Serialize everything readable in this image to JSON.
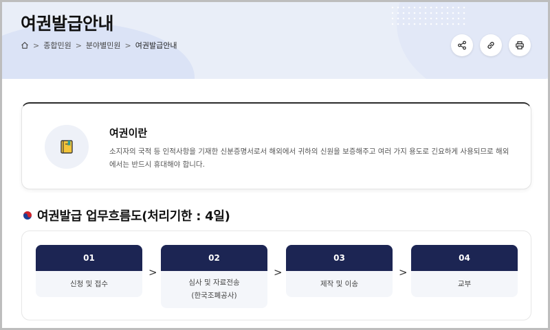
{
  "header": {
    "title": "여권발급안내",
    "breadcrumb": [
      "종합민원",
      "분야별민원",
      "여권발급안내"
    ],
    "tools": [
      {
        "name": "share-icon"
      },
      {
        "name": "link-icon"
      },
      {
        "name": "print-icon"
      }
    ]
  },
  "info": {
    "icon": "passport-book-icon",
    "title": "여권이란",
    "description": "소지자의 국적 등 인적사항을 기재한 신분증명서로서 해외에서 귀하의 신원을 보증해주고 여러 가지 용도로 긴요하게 사용되므로 해외에서는 반드시 휴대해야 합니다."
  },
  "flow": {
    "title": "여권발급 업무흐름도(처리기한 : 4일)",
    "steps": [
      {
        "number": "01",
        "label": "신청 및 접수",
        "sub": ""
      },
      {
        "number": "02",
        "label": "심사 및 자료전송",
        "sub": "(한국조폐공사)"
      },
      {
        "number": "03",
        "label": "제작 및 이송",
        "sub": ""
      },
      {
        "number": "04",
        "label": "교부",
        "sub": ""
      }
    ],
    "arrow": ">"
  },
  "colors": {
    "step_header": "#1c2553",
    "step_body": "#f4f6fa",
    "header_bg": "#e9eef8"
  }
}
